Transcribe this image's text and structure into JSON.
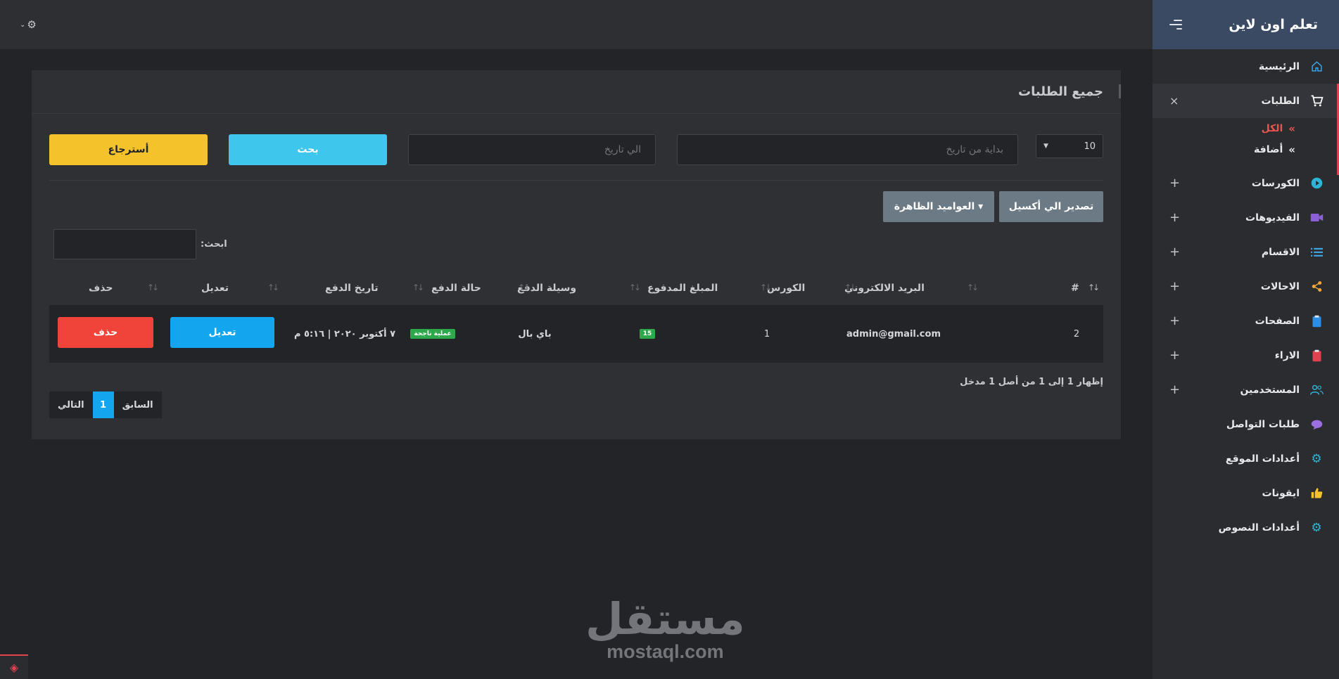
{
  "brand": {
    "title": "تعلم اون لاين"
  },
  "sidebar": {
    "items": [
      {
        "label": "الرئيسية",
        "icon": "home-icon",
        "icon_color": "#3da8e8",
        "tail": ""
      },
      {
        "label": "الطلبات",
        "icon": "cart-icon",
        "icon_color": "#ffffff",
        "tail": "×"
      },
      {
        "label": "الكورسات",
        "icon": "play-circle-icon",
        "icon_color": "#2bb5d6",
        "tail": "+"
      },
      {
        "label": "الفيديوهات",
        "icon": "video-icon",
        "icon_color": "#8b5fd6",
        "tail": "+"
      },
      {
        "label": "الاقسام",
        "icon": "list-icon",
        "icon_color": "#3da8e8",
        "tail": "+"
      },
      {
        "label": "الاحالات",
        "icon": "share-icon",
        "icon_color": "#f0a53a",
        "tail": "+"
      },
      {
        "label": "الصفحات",
        "icon": "clipboard-icon",
        "icon_color": "#2b8fe8",
        "tail": "+"
      },
      {
        "label": "الاراء",
        "icon": "clipboard-icon",
        "icon_color": "#e0434f",
        "tail": "+"
      },
      {
        "label": "المستخدمين",
        "icon": "users-icon",
        "icon_color": "#2bb5d6",
        "tail": "+"
      },
      {
        "label": "طلبات التواصل",
        "icon": "chat-icon",
        "icon_color": "#9b6fe0",
        "tail": ""
      },
      {
        "label": "أعدادات الموقع",
        "icon": "gear-icon",
        "icon_color": "#2bb5d6",
        "tail": ""
      },
      {
        "label": "ايقونات",
        "icon": "thumbs-up-icon",
        "icon_color": "#f4c22b",
        "tail": ""
      },
      {
        "label": "أعدادات النصوص",
        "icon": "gear-icon",
        "icon_color": "#2bb5d6",
        "tail": ""
      }
    ],
    "orders_sub": [
      {
        "label": "الكل"
      },
      {
        "label": "أضافة"
      }
    ]
  },
  "panel": {
    "title": "جميع الطلبات"
  },
  "filters": {
    "length_value": "10",
    "from_placeholder": "بداية من تاريخ",
    "to_placeholder": "الي تاريخ",
    "search_label": "بحث",
    "restore_label": "أسترجاع"
  },
  "toolbar": {
    "excel_label": "تصدير الي أكسيل",
    "columns_label": "العواميد الظاهرة ▾"
  },
  "table": {
    "search_label": "ابحث:",
    "search_value": "",
    "headers": [
      "#",
      "البريد الالكتروني",
      "الكورس",
      "المبلغ المدفوع",
      "وسيلة الدفع",
      "حالة الدفع",
      "تاريخ الدفع",
      "تعديل",
      "حذف"
    ],
    "rows": [
      {
        "id": "2",
        "email": "admin@gmail.com",
        "course": "1",
        "amount": "15",
        "method": "باي بال",
        "status": "عملية ناجحة",
        "date": "٧ أكتوبر ٢٠٢٠ | ٥:١٦ م",
        "edit": "تعديل",
        "delete": "حذف"
      }
    ]
  },
  "info": "إظهار 1 إلى 1 من أصل 1 مدخل",
  "pager": {
    "prev": "السابق",
    "current": "1",
    "next": "التالي"
  },
  "watermark": {
    "arabic": "مستقل",
    "latin": "mostaql.com"
  }
}
